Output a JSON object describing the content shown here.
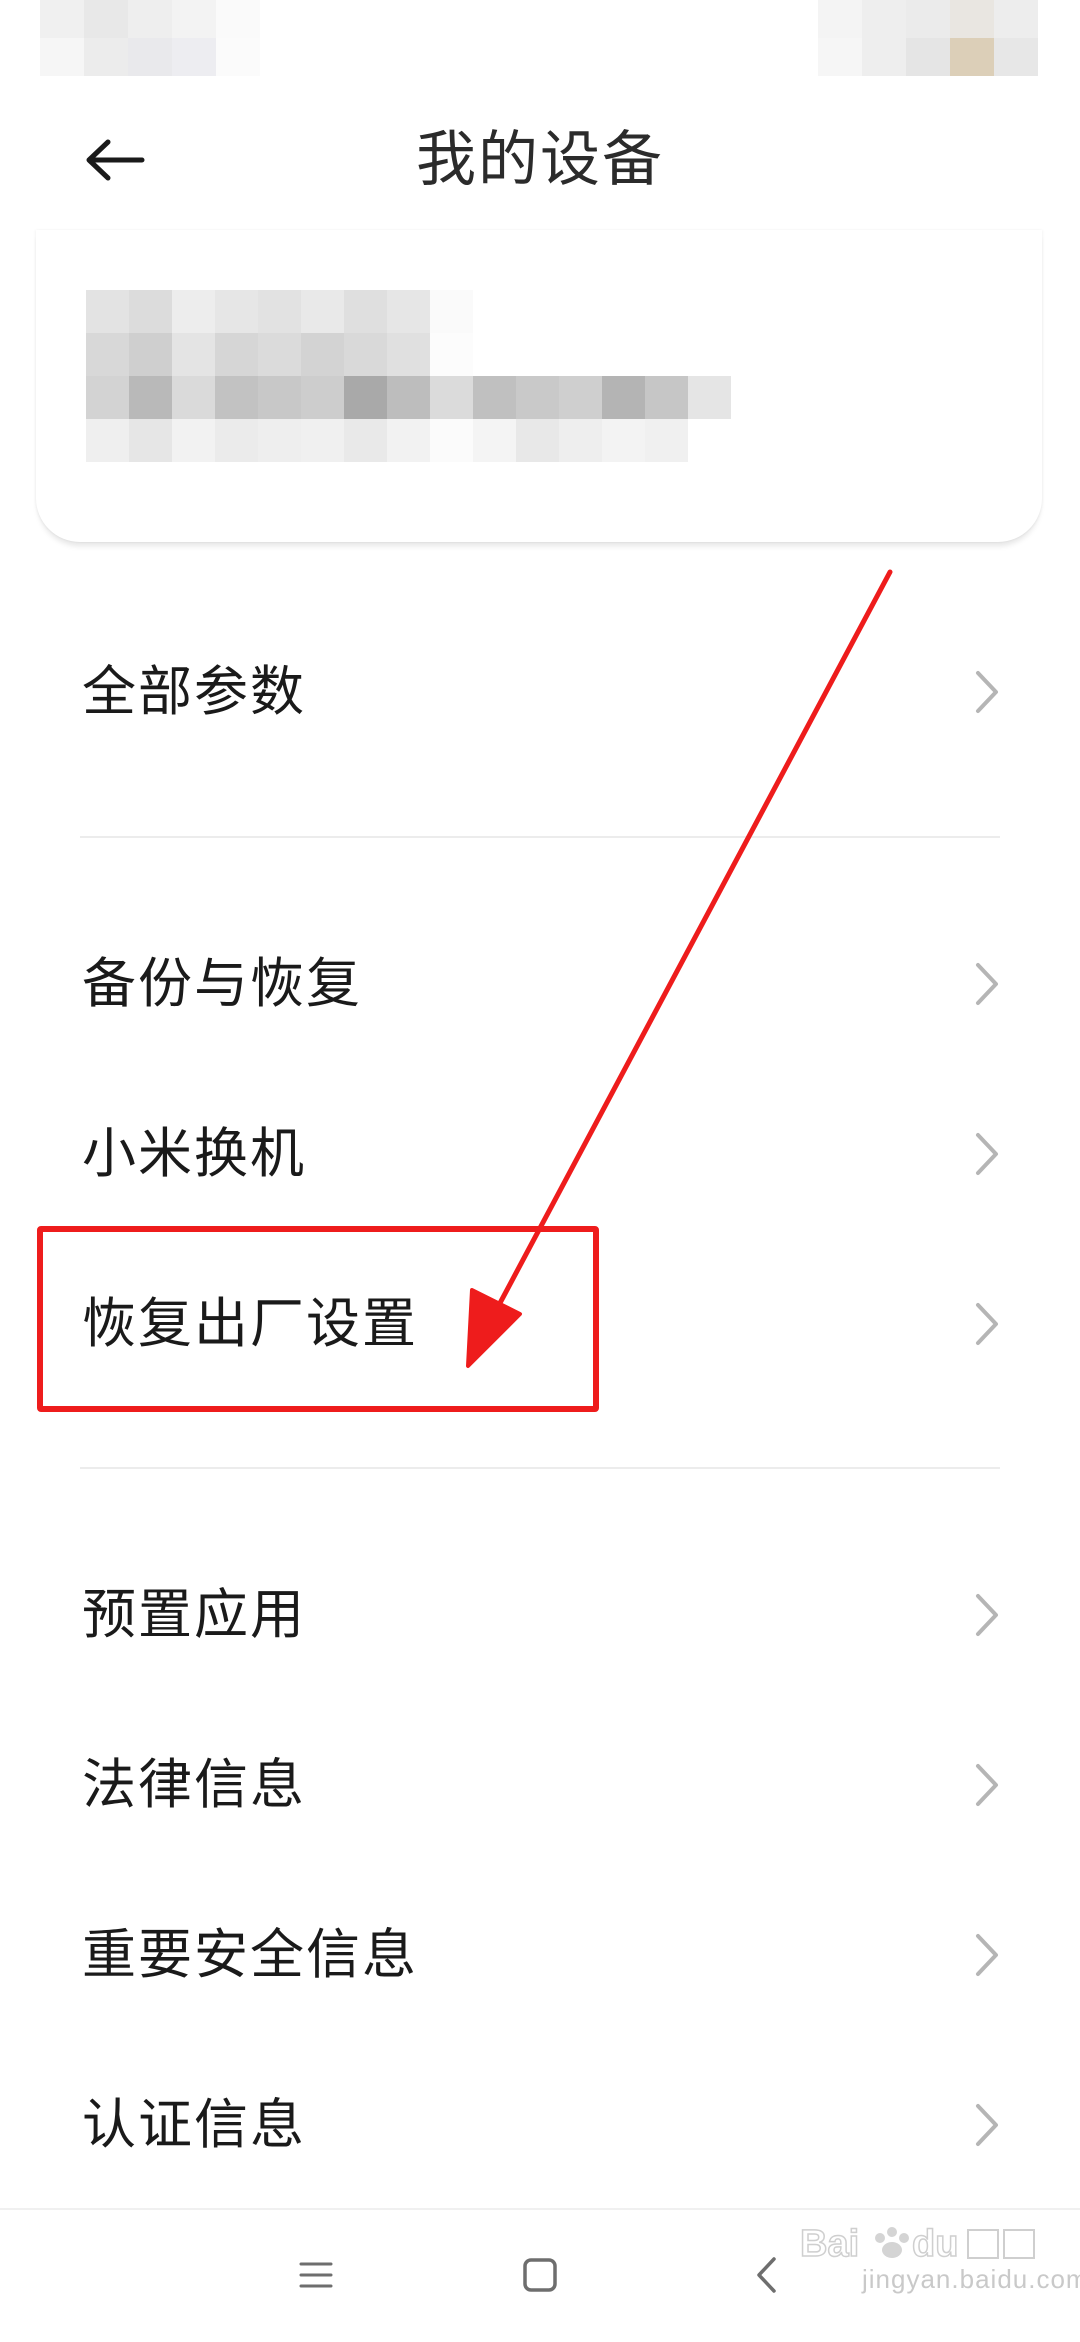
{
  "header": {
    "title": "我的设备",
    "back_icon": "arrow-left-icon"
  },
  "device_card": {
    "content": "blurred"
  },
  "menu": {
    "items": [
      {
        "label": "全部参数",
        "icon": "chevron-right-icon"
      },
      {
        "label": "备份与恢复",
        "icon": "chevron-right-icon"
      },
      {
        "label": "小米换机",
        "icon": "chevron-right-icon"
      },
      {
        "label": "恢复出厂设置",
        "icon": "chevron-right-icon",
        "highlighted": true
      },
      {
        "label": "预置应用",
        "icon": "chevron-right-icon"
      },
      {
        "label": "法律信息",
        "icon": "chevron-right-icon"
      },
      {
        "label": "重要安全信息",
        "icon": "chevron-right-icon"
      },
      {
        "label": "认证信息",
        "icon": "chevron-right-icon"
      }
    ]
  },
  "annotation": {
    "color": "#ee1c1c",
    "target": "恢复出厂设置"
  },
  "navbar": {
    "menu_icon": "hamburger-icon",
    "home_icon": "square-home-icon",
    "back_icon": "chevron-left-icon"
  },
  "watermark": {
    "text": "jingyan.baidu.com",
    "logo": "baidu-jingyan-logo"
  },
  "colors": {
    "background": "#ffffff",
    "text": "#1a1a1a",
    "divider": "#ececec",
    "chevron": "#b5b5b5",
    "annotation": "#ee1c1c"
  }
}
